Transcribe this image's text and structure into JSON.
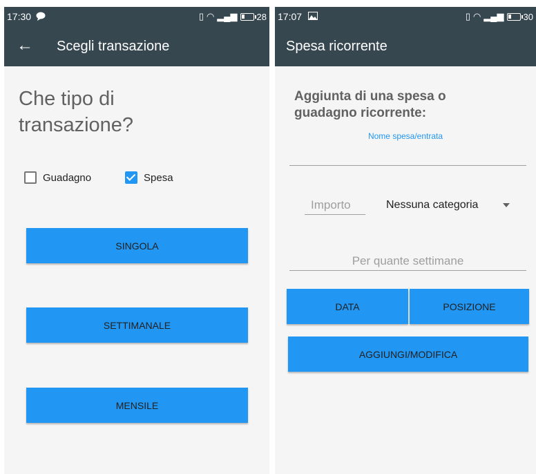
{
  "left": {
    "status": {
      "time": "17:30",
      "battery": "28",
      "battery_level": 0.28,
      "notif_icon": "chat-bubble-icon"
    },
    "appbar": {
      "title": "Scegli transazione",
      "back_icon": "arrow-back-icon"
    },
    "headline": "Che tipo di transazione?",
    "checkboxes": [
      {
        "label": "Guadagno",
        "checked": false
      },
      {
        "label": "Spesa",
        "checked": true
      }
    ],
    "buttons": {
      "single": "SINGOLA",
      "weekly": "SETTIMANALE",
      "monthly": "MENSILE"
    }
  },
  "right": {
    "status": {
      "time": "17:07",
      "battery": "30",
      "battery_level": 0.3,
      "notif_icon": "image-icon"
    },
    "appbar": {
      "title": "Spesa ricorrente"
    },
    "subhead": "Aggiunta di una spesa o guadagno ricorrente:",
    "name_field": {
      "label": "Nome spesa/entrata",
      "value": ""
    },
    "amount_field": {
      "placeholder": "Importo"
    },
    "category": {
      "selected": "Nessuna categoria"
    },
    "weeks_field": {
      "placeholder": "Per quante settimane"
    },
    "buttons": {
      "date": "DATA",
      "position": "POSIZIONE",
      "add": "AGGIUNGI/MODIFICA"
    }
  },
  "colors": {
    "appbar": "#37474f",
    "accent": "#2196f3",
    "background": "#f5f5f5"
  }
}
